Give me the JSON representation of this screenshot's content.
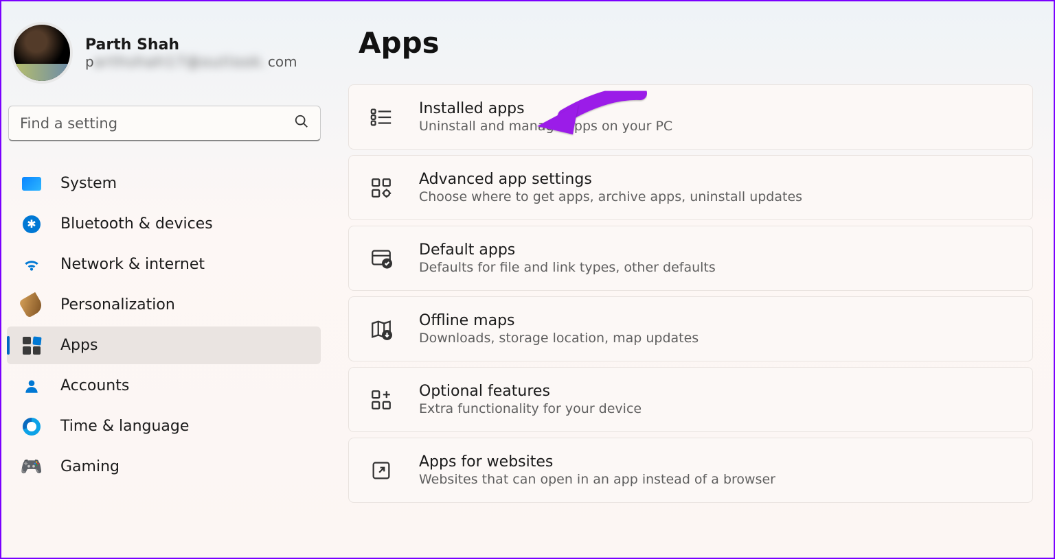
{
  "profile": {
    "name": "Parth Shah",
    "email_prefix": "p",
    "email_blur": "arthshah17@outlook.",
    "email_suffix": "com"
  },
  "search": {
    "placeholder": "Find a setting"
  },
  "page": {
    "title": "Apps"
  },
  "nav": [
    {
      "id": "system",
      "label": "System"
    },
    {
      "id": "bluetooth",
      "label": "Bluetooth & devices"
    },
    {
      "id": "network",
      "label": "Network & internet"
    },
    {
      "id": "personalization",
      "label": "Personalization"
    },
    {
      "id": "apps",
      "label": "Apps"
    },
    {
      "id": "accounts",
      "label": "Accounts"
    },
    {
      "id": "time",
      "label": "Time & language"
    },
    {
      "id": "gaming",
      "label": "Gaming"
    }
  ],
  "cards": [
    {
      "id": "installed-apps",
      "title": "Installed apps",
      "sub": "Uninstall and manage apps on your PC"
    },
    {
      "id": "advanced-app-settings",
      "title": "Advanced app settings",
      "sub": "Choose where to get apps, archive apps, uninstall updates"
    },
    {
      "id": "default-apps",
      "title": "Default apps",
      "sub": "Defaults for file and link types, other defaults"
    },
    {
      "id": "offline-maps",
      "title": "Offline maps",
      "sub": "Downloads, storage location, map updates"
    },
    {
      "id": "optional-features",
      "title": "Optional features",
      "sub": "Extra functionality for your device"
    },
    {
      "id": "apps-for-websites",
      "title": "Apps for websites",
      "sub": "Websites that can open in an app instead of a browser"
    }
  ]
}
